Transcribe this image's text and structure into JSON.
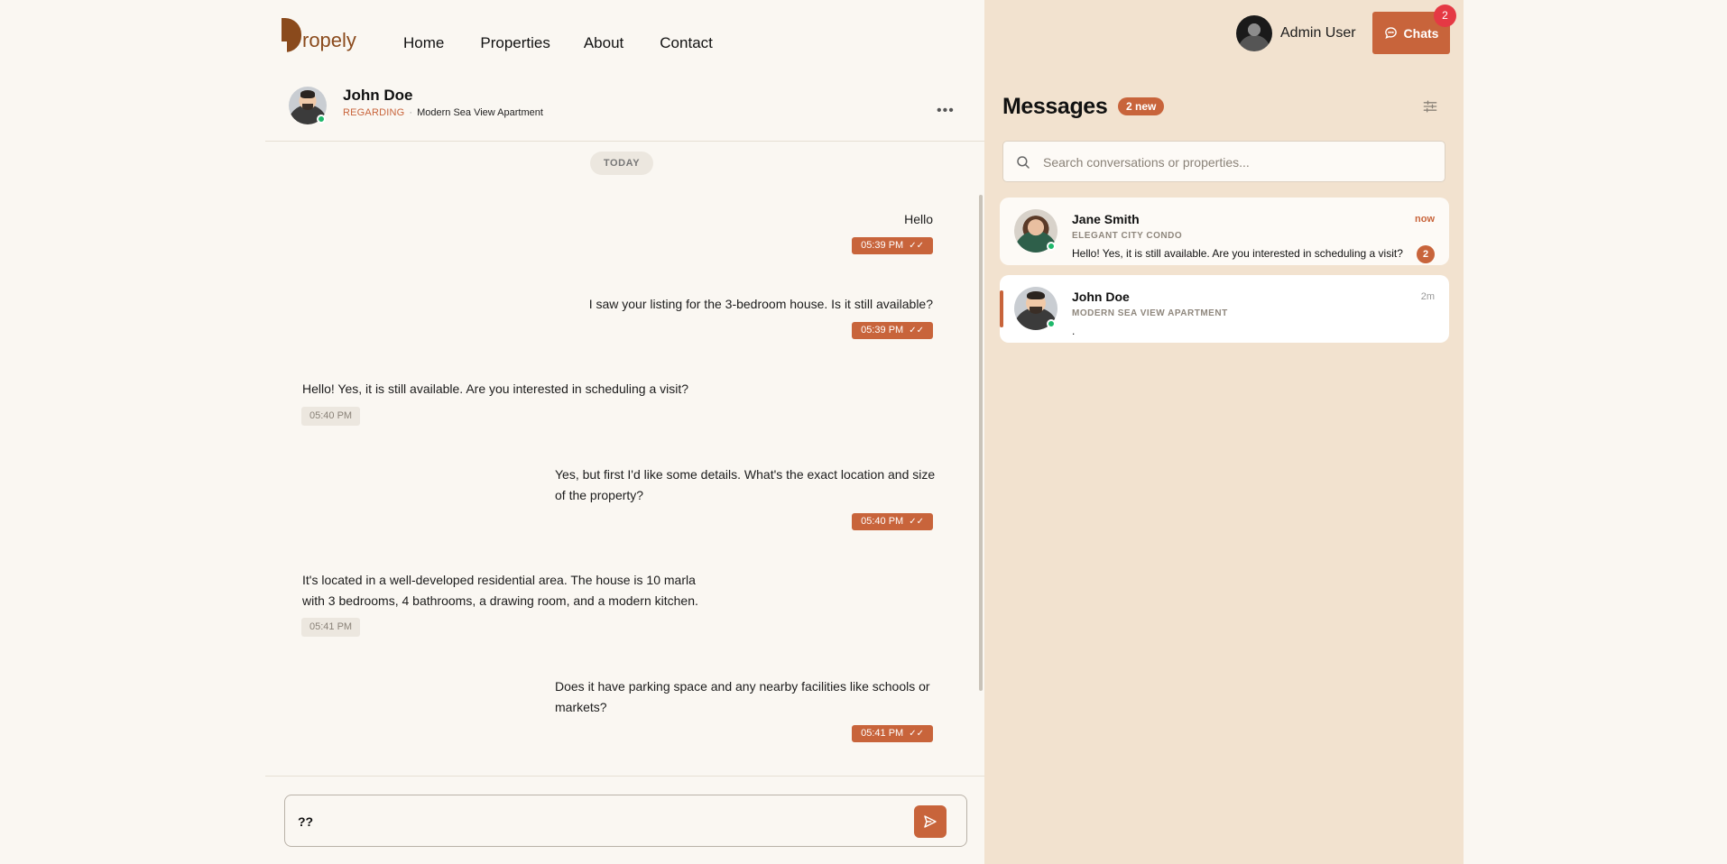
{
  "brand": {
    "logo_text": "ropely"
  },
  "nav": {
    "items": [
      "Home",
      "Properties",
      "About",
      "Contact"
    ]
  },
  "chat": {
    "contact_name": "John Doe",
    "regarding_label": "REGARDING",
    "separator": "·",
    "property": "Modern Sea View Apartment",
    "more_label": "•••",
    "day_label": "TODAY",
    "messages": [
      {
        "dir": "out",
        "text": "Hello",
        "time": "05:39 PM"
      },
      {
        "dir": "out",
        "text": "I saw your listing for the 3-bedroom house. Is it still available?",
        "time": "05:39 PM"
      },
      {
        "dir": "in",
        "text": "Hello! Yes, it is still available. Are you interested in scheduling a visit?",
        "time": "05:40 PM"
      },
      {
        "dir": "out",
        "text": "Yes, but first I'd like some details. What's the exact location and size of the property?",
        "time": "05:40 PM"
      },
      {
        "dir": "in",
        "text": "It's located in a well-developed residential area. The house is 10 marla with 3 bedrooms, 4 bathrooms, a drawing room, and a modern kitchen.",
        "time": "05:41 PM"
      },
      {
        "dir": "out",
        "text": "Does it have parking space and any nearby facilities like schools or markets?",
        "time": "05:41 PM"
      }
    ],
    "read_ticks": "✓✓",
    "composer_value": "??"
  },
  "header": {
    "admin_name": "Admin User",
    "chats_label": "Chats",
    "chats_badge": "2"
  },
  "inbox": {
    "title": "Messages",
    "new_label": "2 new",
    "search_placeholder": "Search conversations or properties...",
    "conversations": [
      {
        "name": "Jane Smith",
        "property": "ELEGANT CITY CONDO",
        "preview": "Hello! Yes, it is still available. Are you interested in scheduling a visit?",
        "time": "now",
        "unread": "2"
      },
      {
        "name": "John Doe",
        "property": "MODERN SEA VIEW APARTMENT",
        "preview": ".",
        "time": "2m"
      }
    ]
  },
  "colors": {
    "accent": "#c8643b",
    "brand": "#8a4a1c",
    "panel": "#f2e2cf",
    "online": "#1fb86b",
    "badge": "#e53944"
  }
}
